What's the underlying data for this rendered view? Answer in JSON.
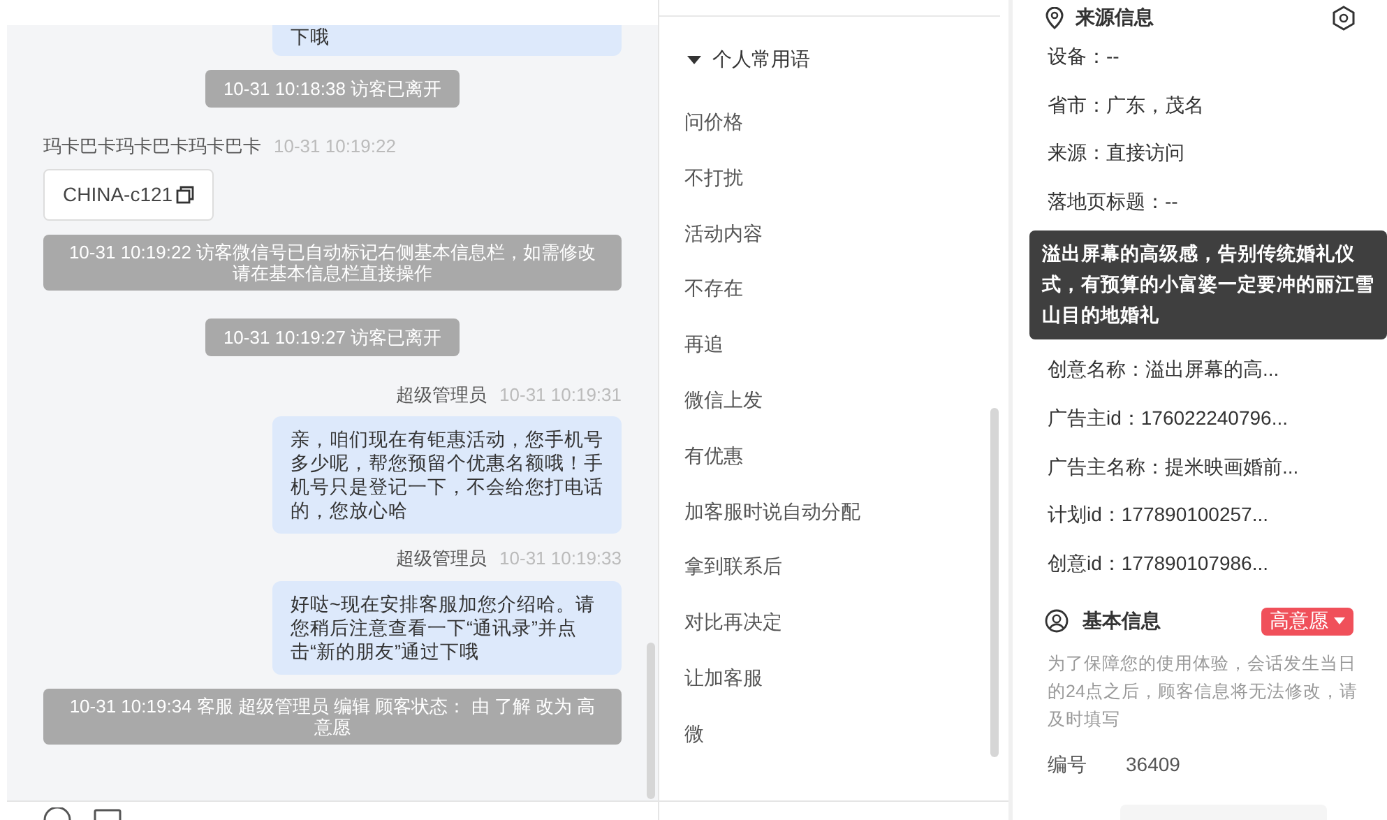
{
  "chat": {
    "items": [
      {
        "kind": "bubble",
        "text": "下哦",
        "partial": true
      },
      {
        "kind": "notice",
        "text": "10-31 10:18:38 访客已离开",
        "wide": false
      },
      {
        "kind": "visitor_header",
        "name": "玛卡巴卡玛卡巴卡玛卡巴卡",
        "time": "10-31 10:19:22"
      },
      {
        "kind": "card",
        "text": "CHINA-c121"
      },
      {
        "kind": "notice",
        "text": "10-31 10:19:22 访客微信号已自动标记右侧基本信息栏，如需修改请在基本信息栏直接操作",
        "wide": true
      },
      {
        "kind": "notice",
        "text": "10-31 10:19:27 访客已离开",
        "wide": false
      },
      {
        "kind": "agent_header",
        "name": "超级管理员",
        "time": "10-31 10:19:31"
      },
      {
        "kind": "bubble",
        "text": "亲，咱们现在有钜惠活动，您手机号多少呢，帮您预留个优惠名额哦！手机号只是登记一下，不会给您打电话的，您放心哈",
        "partial": false
      },
      {
        "kind": "agent_header",
        "name": "超级管理员",
        "time": "10-31 10:19:33"
      },
      {
        "kind": "bubble",
        "text": "好哒~现在安排客服加您介绍哈。请您稍后注意查看一下“通讯录”并点击“新的朋友”通过下哦",
        "partial": false
      },
      {
        "kind": "notice",
        "text": "10-31 10:19:34 客服 超级管理员 编辑 顾客状态： 由 了解 改为 高意愿",
        "wide": true
      }
    ]
  },
  "phrases": {
    "group": {
      "label": "个人常用语",
      "expanded": true
    },
    "items": [
      "问价格",
      "不打扰",
      "活动内容",
      "不存在",
      "再追",
      "微信上发",
      "有优惠",
      "加客服时说自动分配",
      "拿到联系后",
      "对比再决定",
      "让加客服",
      "微"
    ]
  },
  "source_info": {
    "title": "来源信息",
    "rows": [
      {
        "kind": "row",
        "text": "设备：--"
      },
      {
        "kind": "row",
        "text": "省市：广东，茂名"
      },
      {
        "kind": "row",
        "text": "来源：直接访问"
      },
      {
        "kind": "row",
        "text": "落地页标题：--"
      },
      {
        "kind": "tooltip",
        "text": "溢出屏幕的高级感，告别传统婚礼仪式，有预算的小富婆一定要冲的丽江雪山目的地婚礼"
      },
      {
        "kind": "row",
        "text": "创意名称：溢出屏幕的高..."
      },
      {
        "kind": "row",
        "text": "广告主id：176022240796..."
      },
      {
        "kind": "row",
        "text": "广告主名称：提米映画婚前..."
      },
      {
        "kind": "row",
        "text": "计划id：177890100257..."
      },
      {
        "kind": "row",
        "text": "创意id：177890107986..."
      }
    ]
  },
  "basic_info": {
    "title": "基本信息",
    "intent": {
      "label": "高意愿",
      "color": "#f0505a"
    },
    "note": "为了保障您的使用体验，会话发生当日的24点之后，顾客信息将无法修改，请及时填写",
    "fields": [
      {
        "label": "编号",
        "value": "36409"
      }
    ]
  }
}
